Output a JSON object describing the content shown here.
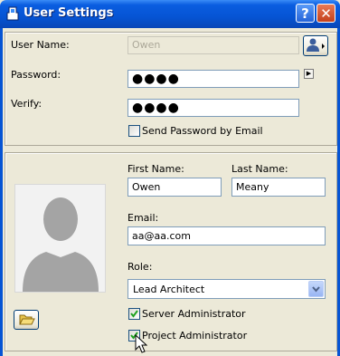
{
  "window": {
    "title": "User Settings",
    "help_label": "?",
    "close_label": "✕"
  },
  "account": {
    "username_label": "User Name:",
    "username_value": "Owen",
    "password_label": "Password:",
    "password_value": "●●●●",
    "verify_label": "Verify:",
    "verify_value": "●●●●",
    "send_email_label": "Send Password by Email",
    "send_email_checked": false
  },
  "profile": {
    "first_name_label": "First Name:",
    "first_name_value": "Owen",
    "last_name_label": "Last Name:",
    "last_name_value": "Meany",
    "email_label": "Email:",
    "email_value": "aa@aa.com",
    "role_label": "Role:",
    "role_value": "Lead Architect",
    "server_admin_label": "Server Administrator",
    "server_admin_checked": true,
    "project_admin_label": "Project Administrator",
    "project_admin_checked": true
  },
  "colors": {
    "title_bar": "#0654d4",
    "dialog_bg": "#ece9d8",
    "field_border": "#7f9db9",
    "check_green": "#21a121"
  },
  "icons": [
    "app-icon",
    "help-icon",
    "close-icon",
    "user-picker-icon",
    "arrow-right-icon",
    "folder-open-icon",
    "dropdown-arrow-icon",
    "mouse-cursor-icon"
  ]
}
